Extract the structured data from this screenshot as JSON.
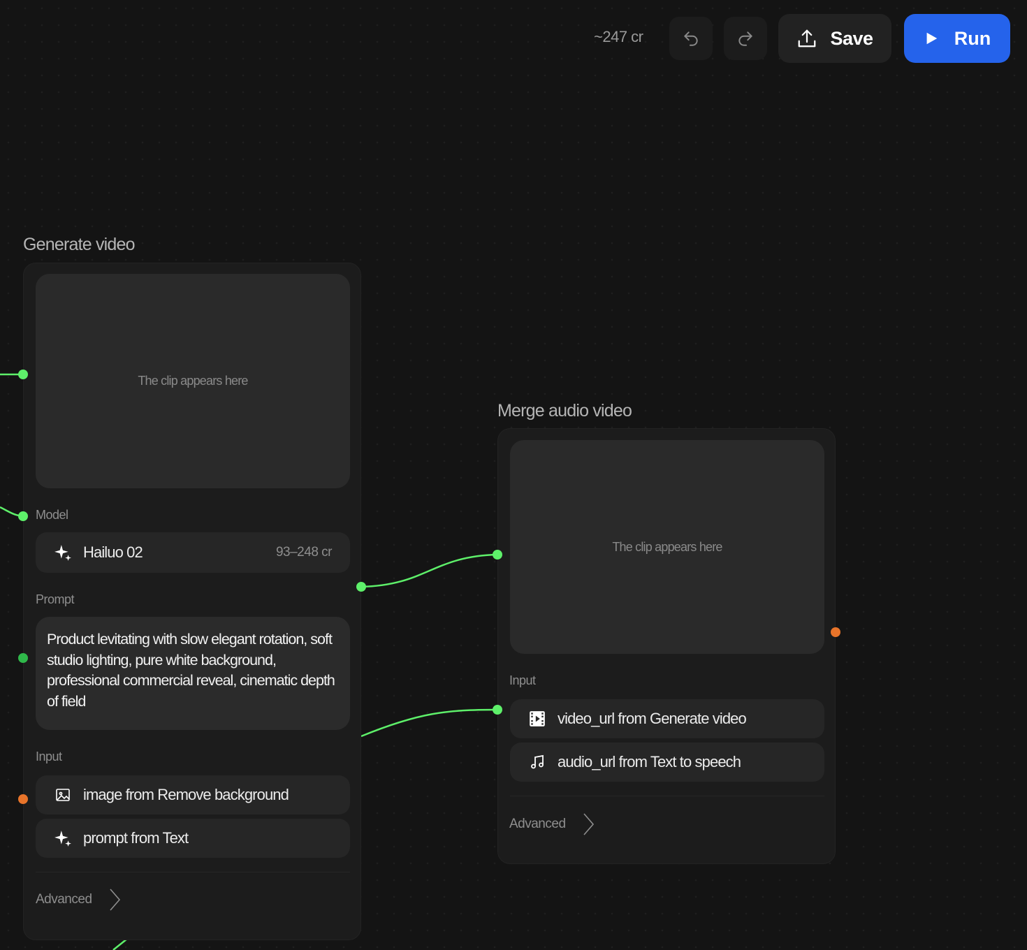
{
  "toolbar": {
    "credits": "~247 cr",
    "undo_icon": "undo-icon",
    "redo_icon": "redo-icon",
    "save_label": "Save",
    "run_label": "Run",
    "accent_color": "#2563eb"
  },
  "generate_node": {
    "title": "Generate video",
    "preview_placeholder": "The clip appears here",
    "model_label": "Model",
    "model_name": "Hailuo 02",
    "model_cost": "93–248 cr",
    "prompt_label": "Prompt",
    "prompt_text": "Product levitating with slow elegant rotation, soft studio lighting, pure white background, professional commercial reveal, cinematic depth of field",
    "input_label": "Input",
    "inputs": [
      {
        "icon": "image-icon",
        "label": "image from Remove background"
      },
      {
        "icon": "sparkle-icon",
        "label": "prompt from Text"
      }
    ],
    "advanced_label": "Advanced"
  },
  "merge_node": {
    "title": "Merge audio video",
    "preview_placeholder": "The clip appears here",
    "input_label": "Input",
    "inputs": [
      {
        "icon": "film-icon",
        "label": "video_url from Generate video"
      },
      {
        "icon": "music-icon",
        "label": "audio_url from Text to speech"
      }
    ],
    "advanced_label": "Advanced"
  },
  "colors": {
    "wire": "#5ef06a",
    "port_orange": "#e8742a"
  }
}
